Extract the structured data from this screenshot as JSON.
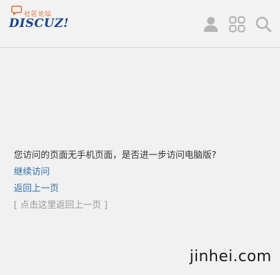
{
  "header": {
    "logo_sub": "社区论坛",
    "logo_main": "DISCUZ!",
    "icons": [
      "user-icon",
      "grid-icon",
      "search-icon"
    ],
    "colors": {
      "logo_blue": "#16428b",
      "logo_orange": "#e16b2c",
      "icon_gray": "#b5b5b5"
    }
  },
  "main": {
    "message": "您访问的页面无手机页面，是否进一步访问电脑版?",
    "continue_link": "继续访问",
    "back_link": "返回上一页",
    "back_hint": "[ 点击这里返回上一页 ]",
    "link_color": "#2f6fa6"
  },
  "watermark": "jinhei.com"
}
